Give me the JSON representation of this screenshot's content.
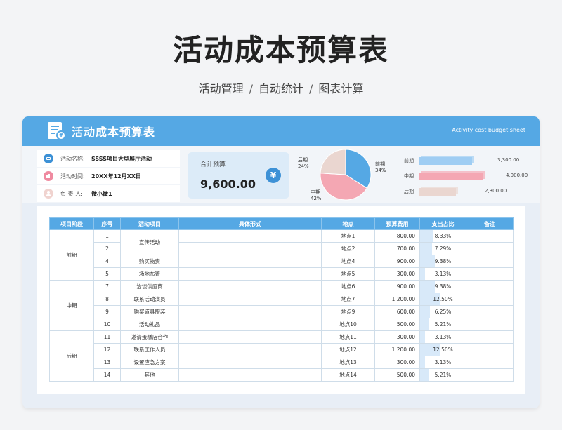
{
  "page": {
    "title": "活动成本预算表",
    "subtitle": [
      "活动管理",
      "自动统计",
      "图表计算"
    ],
    "separator": "/"
  },
  "card": {
    "title": "活动成本预算表",
    "subtitle_en": "Activity cost budget sheet"
  },
  "info": {
    "activity_name_label": "活动名称:",
    "activity_name": "SSSS项目大型展厅活动",
    "activity_time_label": "活动时间:",
    "activity_time": "20XX年12月XX日",
    "owner_label": "负 责 人:",
    "owner": "微小微1"
  },
  "total": {
    "label": "合计预算",
    "value": "9,600.00",
    "icon": "yen-icon"
  },
  "pie": {
    "labels": [
      {
        "name": "后期",
        "pct": "24%"
      },
      {
        "name": "前期",
        "pct": "34%"
      },
      {
        "name": "中期",
        "pct": "42%"
      }
    ]
  },
  "chart_data": {
    "type": "pie",
    "categories": [
      "前期",
      "中期",
      "后期"
    ],
    "values": [
      34,
      42,
      24
    ],
    "colors": [
      "#55a8e4",
      "#f4a7b3",
      "#ead6d0"
    ]
  },
  "bars": {
    "rows": [
      {
        "label": "前期",
        "value": 3300,
        "display": "3,300.00",
        "color": "#9fcdf3"
      },
      {
        "label": "中期",
        "value": 4000,
        "display": "4,000.00",
        "color": "#f4a7b3"
      },
      {
        "label": "后期",
        "value": 2300,
        "display": "2,300.00",
        "color": "#ead6d0"
      }
    ],
    "max": 4000
  },
  "table": {
    "headers": [
      "项目阶段",
      "序号",
      "活动项目",
      "具体形式",
      "地点",
      "预算费用",
      "支出占比",
      "备注"
    ],
    "rows": [
      {
        "stage": "前期",
        "no": "1",
        "item": "宣传活动",
        "form": "",
        "place": "地点1",
        "cost": "800.00",
        "ratio": "8.33%",
        "pct": 8.33,
        "note": ""
      },
      {
        "stage": "前期",
        "no": "2",
        "item": "宣传活动",
        "form": "",
        "place": "地点2",
        "cost": "700.00",
        "ratio": "7.29%",
        "pct": 7.29,
        "note": ""
      },
      {
        "stage": "前期",
        "no": "4",
        "item": "购买物资",
        "form": "",
        "place": "地点4",
        "cost": "900.00",
        "ratio": "9.38%",
        "pct": 9.38,
        "note": ""
      },
      {
        "stage": "前期",
        "no": "5",
        "item": "场地布置",
        "form": "",
        "place": "地点5",
        "cost": "300.00",
        "ratio": "3.13%",
        "pct": 3.13,
        "note": ""
      },
      {
        "stage": "中期",
        "no": "7",
        "item": "洽谈供应商",
        "form": "",
        "place": "地点6",
        "cost": "900.00",
        "ratio": "9.38%",
        "pct": 9.38,
        "note": ""
      },
      {
        "stage": "中期",
        "no": "8",
        "item": "联系活动演员",
        "form": "",
        "place": "地点7",
        "cost": "1,200.00",
        "ratio": "12.50%",
        "pct": 12.5,
        "note": ""
      },
      {
        "stage": "中期",
        "no": "9",
        "item": "购买道具服装",
        "form": "",
        "place": "地点9",
        "cost": "600.00",
        "ratio": "6.25%",
        "pct": 6.25,
        "note": ""
      },
      {
        "stage": "中期",
        "no": "10",
        "item": "活动礼品",
        "form": "",
        "place": "地点10",
        "cost": "500.00",
        "ratio": "5.21%",
        "pct": 5.21,
        "note": ""
      },
      {
        "stage": "后期",
        "no": "11",
        "item": "邀请蛋糕店合作",
        "form": "",
        "place": "地点11",
        "cost": "300.00",
        "ratio": "3.13%",
        "pct": 3.13,
        "note": ""
      },
      {
        "stage": "后期",
        "no": "12",
        "item": "联系工作人员",
        "form": "",
        "place": "地点12",
        "cost": "1,200.00",
        "ratio": "12.50%",
        "pct": 12.5,
        "note": ""
      },
      {
        "stage": "后期",
        "no": "13",
        "item": "设置应急方案",
        "form": "",
        "place": "地点13",
        "cost": "300.00",
        "ratio": "3.13%",
        "pct": 3.13,
        "note": ""
      },
      {
        "stage": "后期",
        "no": "14",
        "item": "其他",
        "form": "",
        "place": "地点14",
        "cost": "500.00",
        "ratio": "5.21%",
        "pct": 5.21,
        "note": ""
      }
    ]
  }
}
